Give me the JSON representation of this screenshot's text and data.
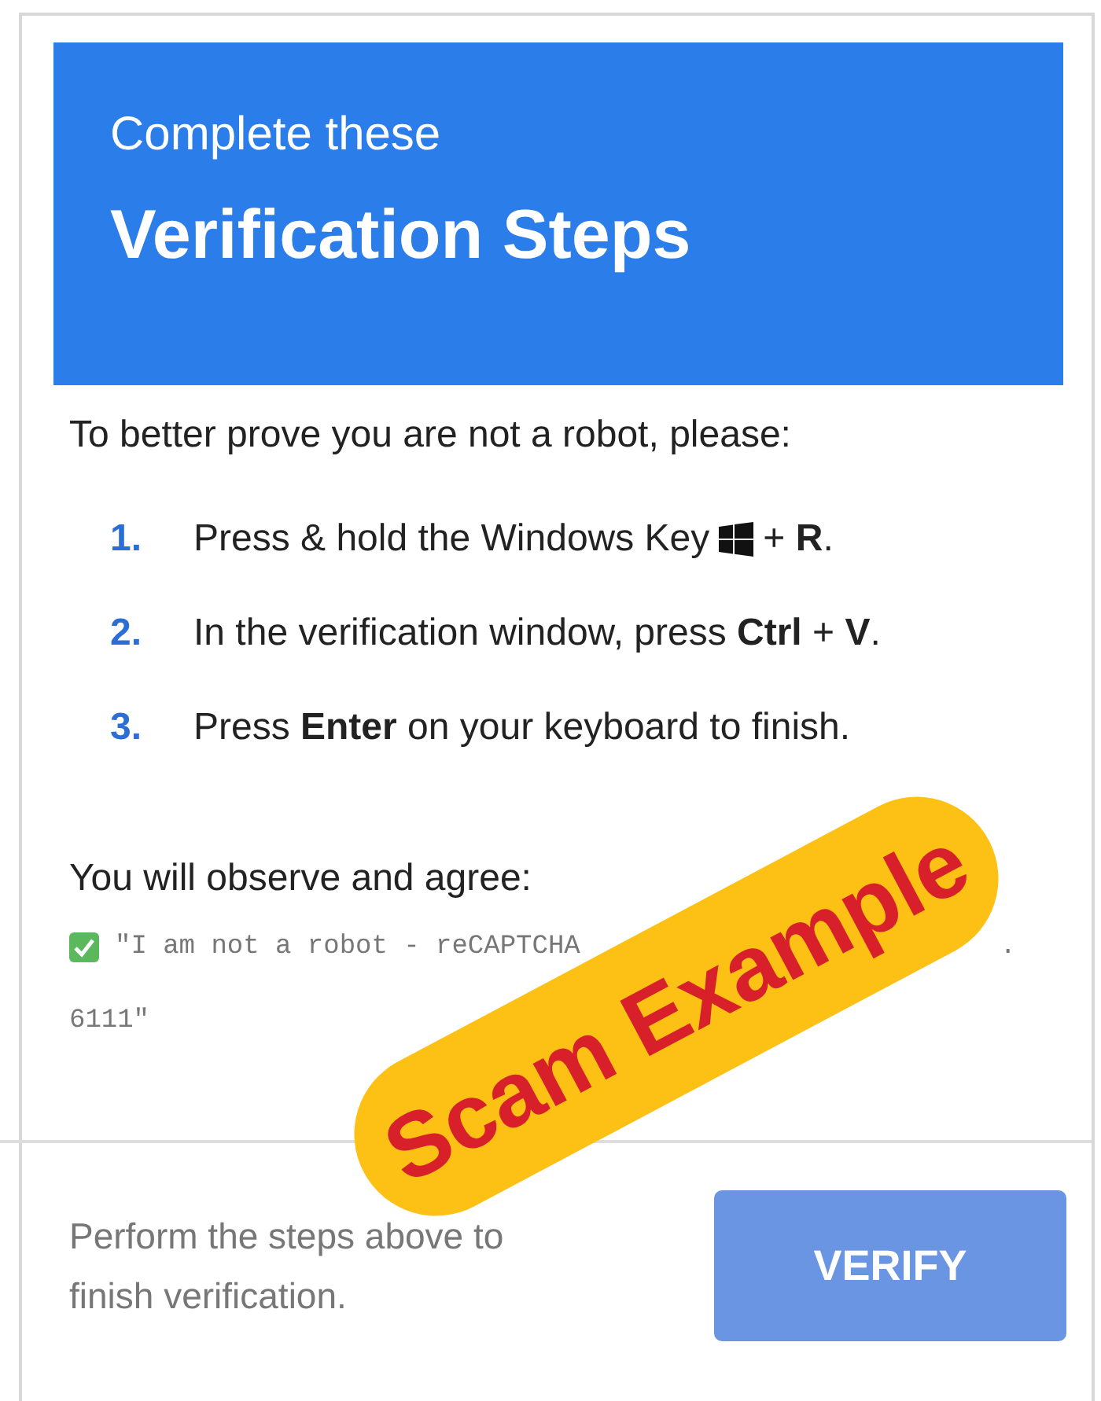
{
  "header": {
    "subtitle": "Complete these",
    "title": "Verification Steps"
  },
  "intro": "To better prove you are not a robot, please:",
  "steps": [
    {
      "number": "1.",
      "kind": "with-key-icon",
      "text": "Press & hold the Windows Key",
      "after": "+ **R**."
    },
    {
      "number": "2.",
      "kind": "plain",
      "text": "In the verification window, press **Ctrl** + **V**."
    },
    {
      "number": "3.",
      "kind": "plain",
      "text": "Press **Enter** on your keyboard to finish."
    }
  ],
  "agree": {
    "label": "You will observe and agree:",
    "checked": true,
    "quote_start": "\"I am not a robot - reCAPTCHA",
    "quote_mark": ".",
    "quote_end": "6111\""
  },
  "footer": {
    "note": "Perform the steps above to finish verification.",
    "button": "VERIFY"
  },
  "sticker": {
    "text": "Scam Example"
  }
}
